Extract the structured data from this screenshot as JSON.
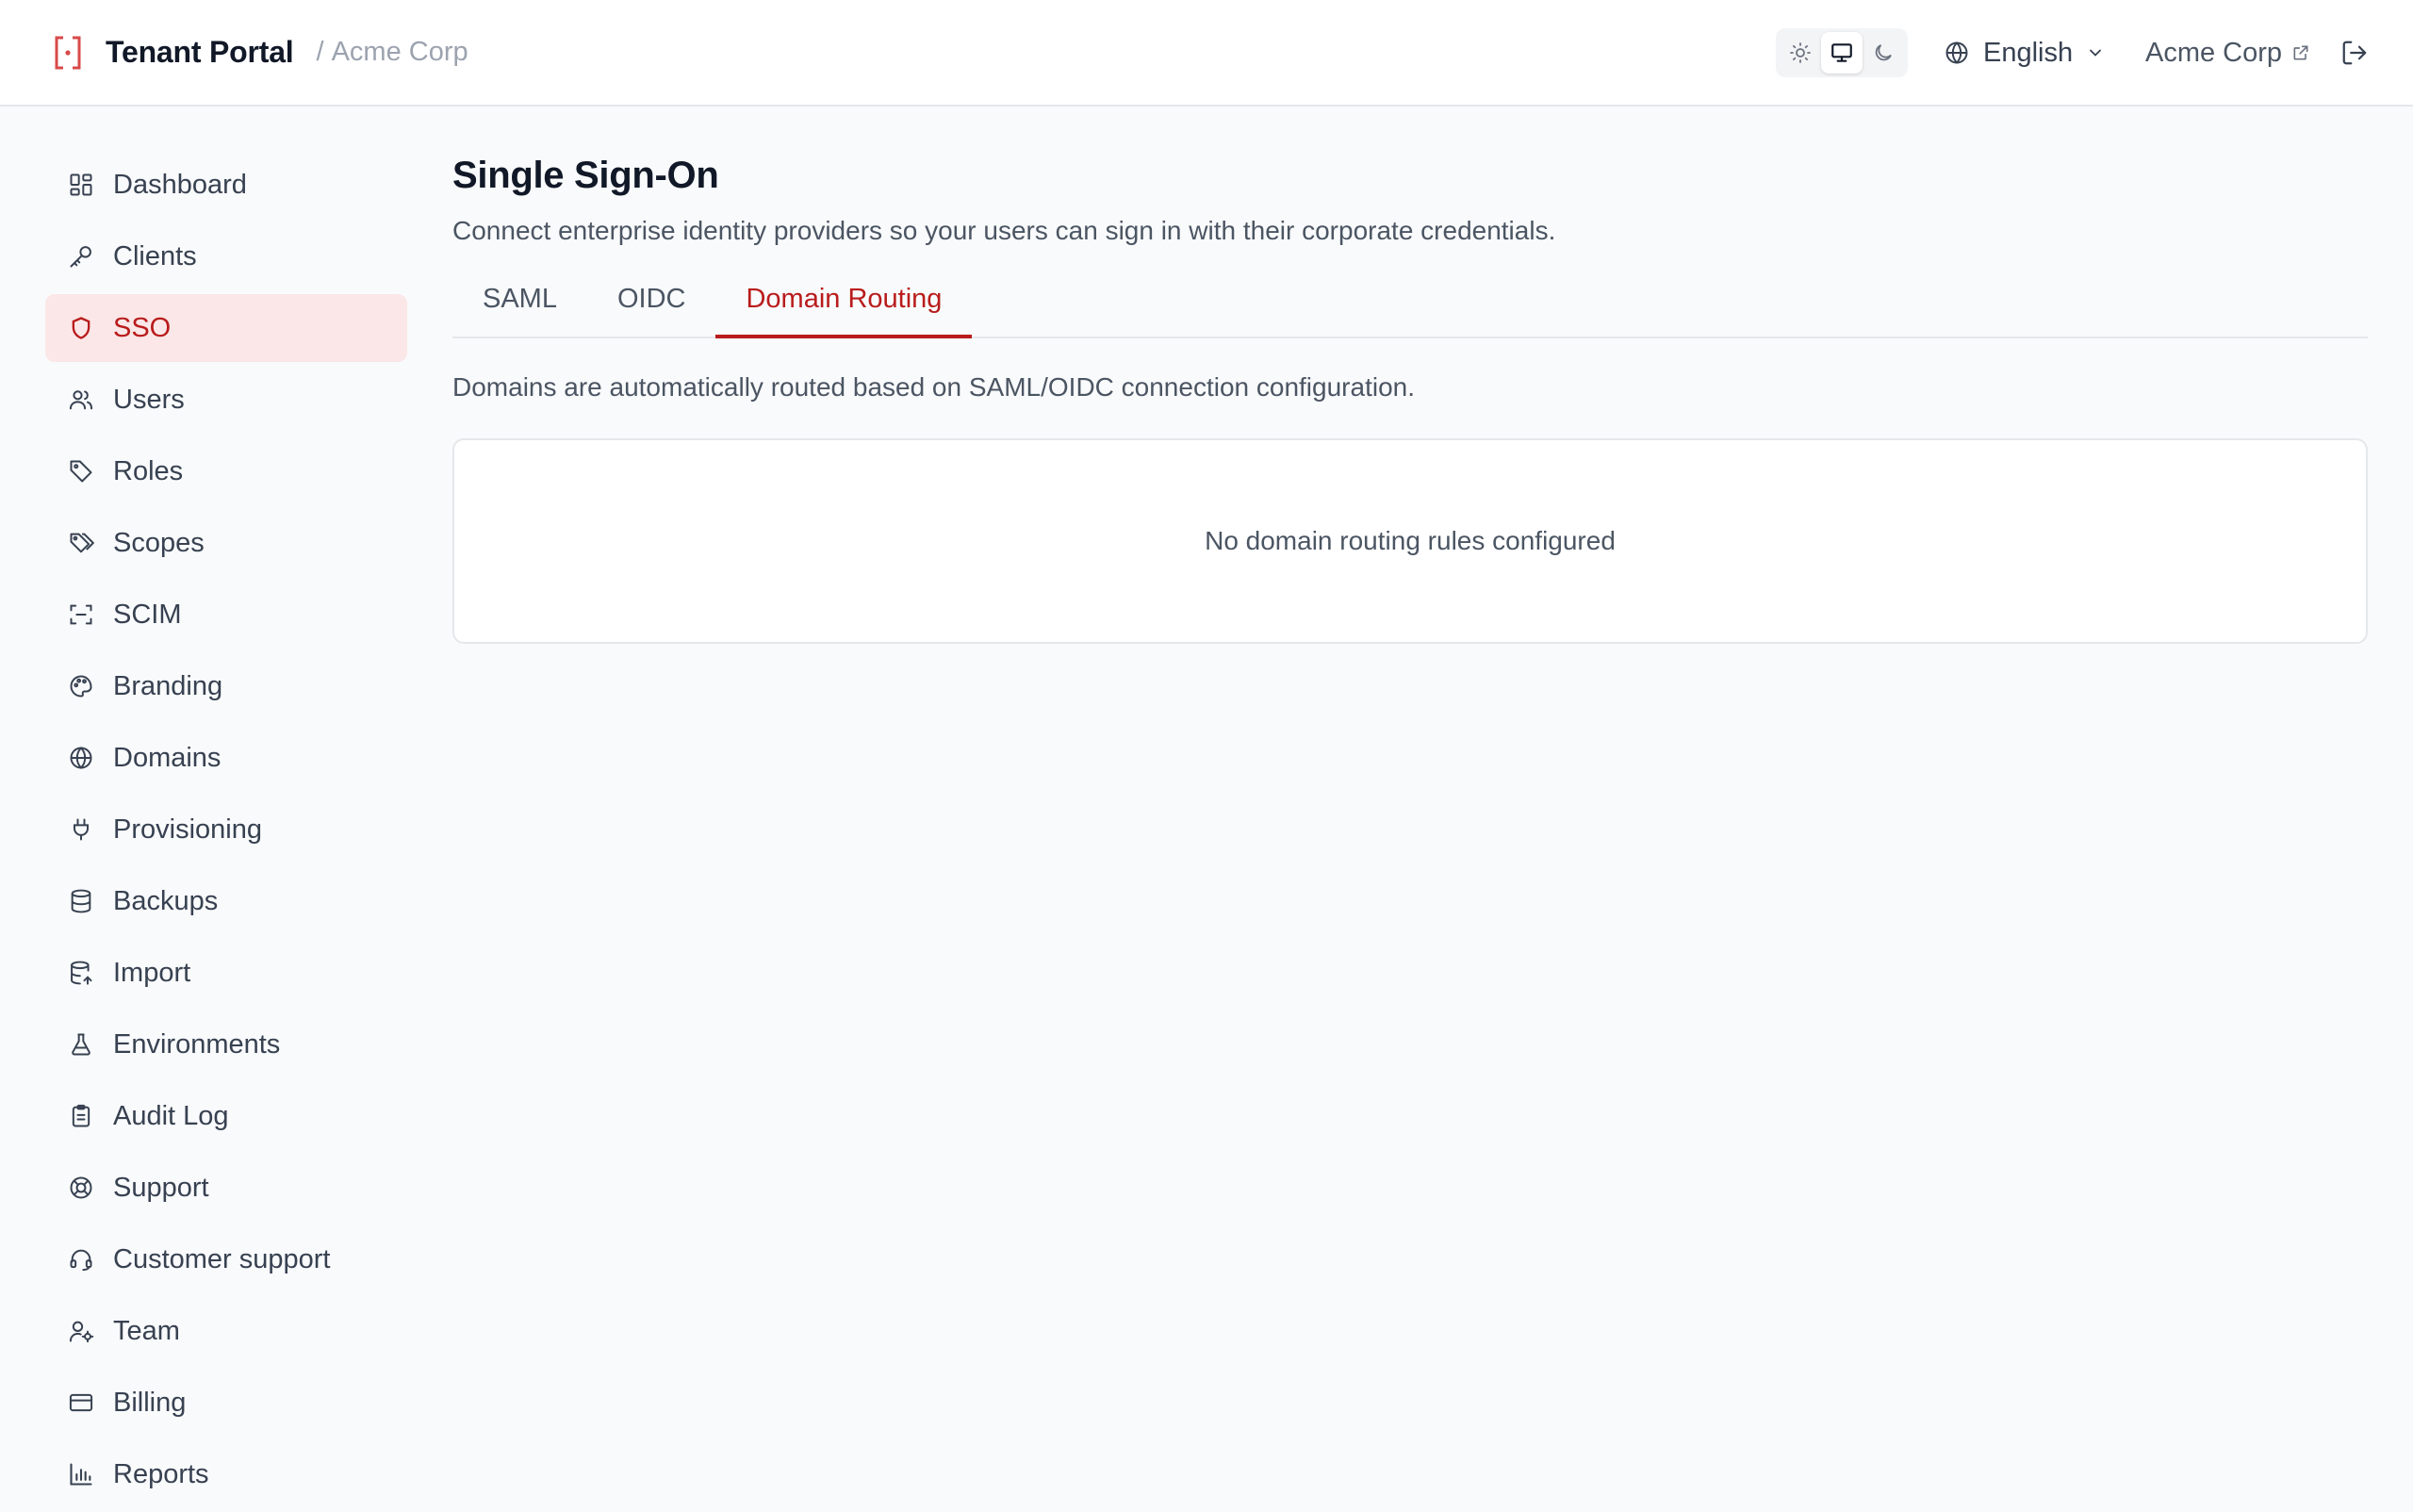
{
  "header": {
    "title": "Tenant Portal",
    "separator": "/",
    "org": "Acme Corp",
    "language": "English",
    "org_link": "Acme Corp",
    "accent": "#d94a4a"
  },
  "sidebar": {
    "active_color": "#b91c1c",
    "items": [
      {
        "label": "Dashboard",
        "icon": "dashboard-icon"
      },
      {
        "label": "Clients",
        "icon": "key-icon"
      },
      {
        "label": "SSO",
        "icon": "shield-icon",
        "active": true
      },
      {
        "label": "Users",
        "icon": "users-icon"
      },
      {
        "label": "Roles",
        "icon": "tag-icon"
      },
      {
        "label": "Scopes",
        "icon": "tags-icon"
      },
      {
        "label": "SCIM",
        "icon": "scan-icon"
      },
      {
        "label": "Branding",
        "icon": "palette-icon"
      },
      {
        "label": "Domains",
        "icon": "globe-icon"
      },
      {
        "label": "Provisioning",
        "icon": "plug-icon"
      },
      {
        "label": "Backups",
        "icon": "database-icon"
      },
      {
        "label": "Import",
        "icon": "database-import-icon"
      },
      {
        "label": "Environments",
        "icon": "flask-icon"
      },
      {
        "label": "Audit Log",
        "icon": "clipboard-icon"
      },
      {
        "label": "Support",
        "icon": "life-buoy-icon"
      },
      {
        "label": "Customer support",
        "icon": "headset-icon"
      },
      {
        "label": "Team",
        "icon": "user-cog-icon"
      },
      {
        "label": "Billing",
        "icon": "credit-card-icon"
      },
      {
        "label": "Reports",
        "icon": "bar-chart-icon"
      }
    ]
  },
  "main": {
    "title": "Single Sign-On",
    "description": "Connect enterprise identity providers so your users can sign in with their corporate credentials.",
    "tabs": [
      {
        "label": "SAML"
      },
      {
        "label": "OIDC"
      },
      {
        "label": "Domain Routing",
        "active": true
      }
    ],
    "routing_note": "Domains are automatically routed based on SAML/OIDC connection configuration.",
    "empty_state": "No domain routing rules configured"
  }
}
